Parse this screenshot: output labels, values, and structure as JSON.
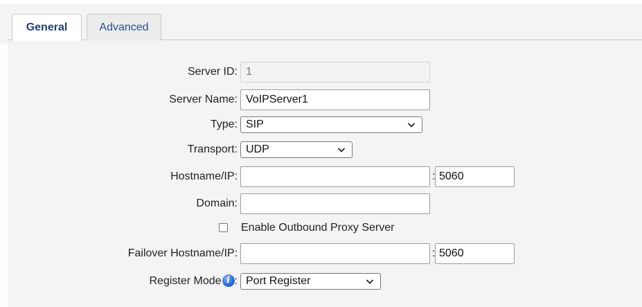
{
  "tabs": [
    {
      "label": "General",
      "active": true
    },
    {
      "label": "Advanced",
      "active": false
    }
  ],
  "form": {
    "server_id": {
      "label": "Server ID:",
      "value": "1",
      "disabled": true
    },
    "server_name": {
      "label": "Server Name:",
      "value": "VoIPServer1"
    },
    "type": {
      "label": "Type:",
      "selected": "SIP"
    },
    "transport": {
      "label": "Transport:",
      "selected": "UDP"
    },
    "hostname": {
      "label": "Hostname/IP:",
      "value": "",
      "port_separator": ":",
      "port": "5060"
    },
    "domain": {
      "label": "Domain:",
      "value": ""
    },
    "outbound_proxy": {
      "label": "Enable Outbound Proxy Server",
      "checked": false
    },
    "failover_hostname": {
      "label": "Failover Hostname/IP:",
      "value": "",
      "port_separator": ":",
      "port": "5060"
    },
    "register_mode": {
      "label": "Register Mode",
      "colon": ":",
      "info_icon": "info-icon",
      "selected": "Port Register"
    }
  },
  "colors": {
    "tab_active_text": "#1f3e7c",
    "tab_inactive_text": "#2d4f8f",
    "panel_background": "#f4f4f4",
    "info_icon": "#2f6fd8"
  }
}
